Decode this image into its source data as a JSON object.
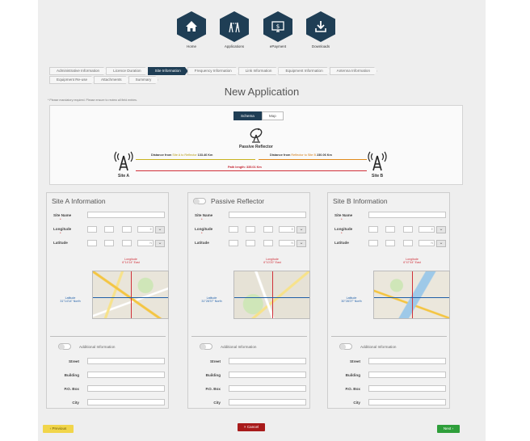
{
  "nav": [
    {
      "label": "Home",
      "icon": "home-icon"
    },
    {
      "label": "Applications",
      "icon": "network-icon"
    },
    {
      "label": "ePayment",
      "icon": "payment-icon"
    },
    {
      "label": "Downloads",
      "icon": "download-icon"
    }
  ],
  "steps_row1": [
    "Administrative Information",
    "Licence Duration",
    "Site Information",
    "Frequency Information",
    "Link Information",
    "Equipment Information",
    "Antenna Information"
  ],
  "steps_row2": [
    "Equipment Re-use",
    "Attachments",
    "Summary"
  ],
  "active_step": "Site Information",
  "page_title": "New Application",
  "note": "* Please mandatory required. Please ensure to review all field entries.",
  "schema": {
    "tabs": [
      "Schema",
      "Map"
    ],
    "active_tab": "Schema",
    "site_a": "Site A",
    "site_b": "Site B",
    "reflector": "Passive Reflector",
    "dist_left_prefix": "Distance from",
    "dist_left_mid": "Site A to Reflector",
    "dist_left_value": "133.46 Km",
    "dist_right_prefix": "Distance from",
    "dist_right_mid": "Reflector to Site B",
    "dist_right_value": "230.06 Km",
    "path_length": "Path length: 335.01 Km"
  },
  "panels": [
    {
      "title": "Site A Information",
      "site_name_label": "Site Name",
      "longitude_label": "Longitude",
      "latitude_label": "Latitude",
      "lon_suffix": "E",
      "lat_suffix": "N",
      "map_top_caption_1": "Longitude",
      "map_top_caption_2": "6°14'14\" East",
      "map_left_caption_1": "Latitude",
      "map_left_caption_2": "31°14'14\" North",
      "additional_label": "Additional Information",
      "street_label": "Street",
      "building_label": "Building",
      "pobox_label": "P.O. Box",
      "city_label": "City"
    },
    {
      "title": "Passive Reflector",
      "site_name_label": "Site Name",
      "longitude_label": "Longitude",
      "latitude_label": "Latitude",
      "lon_suffix": "E",
      "lat_suffix": "N",
      "map_top_caption_1": "Longitude",
      "map_top_caption_2": "6°10'20\" East",
      "map_left_caption_1": "Latitude",
      "map_left_caption_2": "31°28'37\" North",
      "additional_label": "Additional Information",
      "street_label": "Street",
      "building_label": "Building",
      "pobox_label": "P.O. Box",
      "city_label": "City"
    },
    {
      "title": "Site B Information",
      "site_name_label": "Site Name",
      "longitude_label": "Longitude",
      "latitude_label": "Latitude",
      "lon_suffix": "E",
      "lat_suffix": "N",
      "map_top_caption_1": "Longitude",
      "map_top_caption_2": "6°47'44\" East",
      "map_left_caption_1": "Latitude",
      "map_left_caption_2": "30°28'27\" North",
      "additional_label": "Additional Information",
      "street_label": "Street",
      "building_label": "Building",
      "pobox_label": "P.O. Box",
      "city_label": "City"
    }
  ],
  "buttons": {
    "previous": "‹ Previous",
    "cancel": "× Cancel",
    "next": "Next ›"
  },
  "colors": {
    "brand": "#1f3e55",
    "site_a_line": "#c9b320",
    "site_b_line": "#e08a1c",
    "path_line": "#d0303a",
    "previous": "#f1d54a",
    "cancel": "#a81b1b",
    "next": "#2e9e3a"
  }
}
